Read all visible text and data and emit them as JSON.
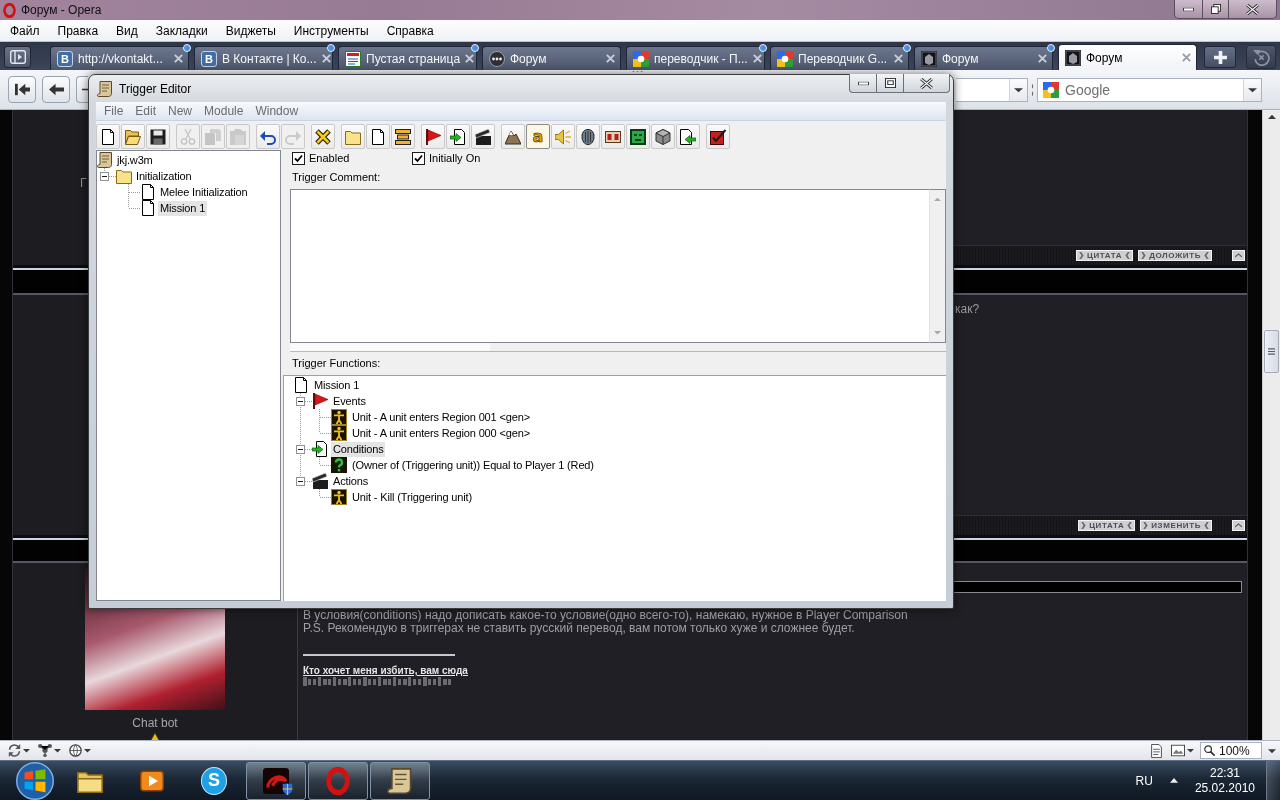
{
  "browser": {
    "title": "Форум - Opera",
    "menu": [
      "Файл",
      "Правка",
      "Вид",
      "Закладки",
      "Виджеты",
      "Инструменты",
      "Справка"
    ],
    "tabs": [
      {
        "kind": "letter",
        "glyph": "В",
        "label": "http://vkontakt...",
        "selected": false,
        "notify": true
      },
      {
        "kind": "letter",
        "glyph": "В",
        "label": "В Контакте | Ко...",
        "selected": false,
        "notify": true
      },
      {
        "kind": "page",
        "label": "Пустая страница",
        "selected": false,
        "notify": true
      },
      {
        "kind": "dots",
        "label": "Форум",
        "selected": false,
        "notify": false
      },
      {
        "kind": "blocks",
        "label": "переводчик - П...",
        "selected": false,
        "notify": true
      },
      {
        "kind": "blocks",
        "label": "Переводчик G...",
        "selected": false,
        "notify": true
      },
      {
        "kind": "dark",
        "label": "Форум",
        "selected": false,
        "notify": true
      },
      {
        "kind": "dark",
        "label": "Форум",
        "selected": true,
        "notify": false
      }
    ],
    "search": {
      "placeholder": "Google"
    },
    "zoom": "100%"
  },
  "forum": {
    "fragment": "Г",
    "footers": [
      {
        "buttons": [
          "ЦИТАТА",
          "ДОЛОЖИТЬ"
        ]
      },
      {
        "buttons": [
          "ЦИТАТА",
          "ИЗМЕНИТЬ"
        ]
      }
    ],
    "question_tail": "как?",
    "author": "Chat bot",
    "reply": [
      "В условия(conditions) надо дописать какое-то условие(одно всего-то), намекаю, нужное в Player Comparison",
      "P.S. Рекомендую в триггерах не ставить русский перевод, вам потом только хуже и сложнее будет."
    ],
    "signature_link": "Кто хочет меня избить, вам сюда"
  },
  "editor": {
    "title": "Trigger Editor",
    "menu": [
      "File",
      "Edit",
      "New",
      "Module",
      "Window"
    ],
    "toolbar": [
      [
        {
          "kind": "new",
          "disabled": false,
          "pressed": false
        },
        {
          "kind": "open",
          "disabled": false,
          "pressed": false
        },
        {
          "kind": "save",
          "disabled": false,
          "pressed": false
        }
      ],
      [
        {
          "kind": "cut",
          "disabled": true,
          "pressed": false
        },
        {
          "kind": "copy",
          "disabled": true,
          "pressed": false
        },
        {
          "kind": "paste",
          "disabled": true,
          "pressed": false
        }
      ],
      [
        {
          "kind": "undo",
          "disabled": false,
          "pressed": false
        },
        {
          "kind": "redo",
          "disabled": true,
          "pressed": false
        }
      ],
      [
        {
          "kind": "variables",
          "disabled": false,
          "pressed": false
        }
      ],
      [
        {
          "kind": "category",
          "disabled": false,
          "pressed": false
        },
        {
          "kind": "trigger",
          "disabled": false,
          "pressed": false
        },
        {
          "kind": "comment",
          "disabled": false,
          "pressed": false
        }
      ],
      [
        {
          "kind": "event",
          "disabled": false,
          "pressed": false
        },
        {
          "kind": "condition",
          "disabled": false,
          "pressed": false
        },
        {
          "kind": "action",
          "disabled": false,
          "pressed": false
        }
      ],
      [
        {
          "kind": "terrain",
          "disabled": false,
          "pressed": false
        },
        {
          "kind": "glyph",
          "glyph": "a",
          "disabled": false,
          "pressed": true
        },
        {
          "kind": "sound",
          "disabled": false,
          "pressed": false
        },
        {
          "kind": "ai",
          "disabled": false,
          "pressed": false
        },
        {
          "kind": "object",
          "disabled": false,
          "pressed": false
        },
        {
          "kind": "campaign",
          "disabled": false,
          "pressed": false
        },
        {
          "kind": "import",
          "disabled": false,
          "pressed": false
        },
        {
          "kind": "export",
          "disabled": false,
          "pressed": false
        }
      ],
      [
        {
          "kind": "test",
          "disabled": false,
          "pressed": false
        }
      ]
    ],
    "trigger_tree": [
      {
        "kind": "map",
        "label": "jkj.w3m",
        "selected": false,
        "children": [
          {
            "kind": "category",
            "label": "Initialization",
            "selected": false,
            "expanded": true,
            "children": [
              {
                "kind": "trigger",
                "label": "Melee Initialization",
                "selected": false
              },
              {
                "kind": "trigger",
                "label": "Mission 1",
                "selected": true
              }
            ]
          }
        ]
      }
    ],
    "options": [
      {
        "label": "Enabled",
        "checked": true
      },
      {
        "label": "Initially On",
        "checked": true
      }
    ],
    "comment": {
      "label": "Trigger Comment:"
    },
    "functions": {
      "label": "Trigger Functions:",
      "tree": [
        {
          "kind": "trigger",
          "label": "Mission 1",
          "selected": false,
          "children": [
            {
              "kind": "events",
              "label": "Events",
              "selected": false,
              "expanded": true,
              "children": [
                {
                  "kind": "unit",
                  "label": "Unit - A unit enters Region 001 <gen>",
                  "selected": false
                },
                {
                  "kind": "unit",
                  "label": "Unit - A unit enters Region 000 <gen>",
                  "selected": false
                }
              ]
            },
            {
              "kind": "conditions",
              "label": "Conditions",
              "selected": true,
              "expanded": true,
              "children": [
                {
                  "kind": "question",
                  "label": "(Owner of (Triggering unit)) Equal to Player 1 (Red)",
                  "selected": false
                }
              ]
            },
            {
              "kind": "actions",
              "label": "Actions",
              "selected": false,
              "expanded": true,
              "children": [
                {
                  "kind": "unit",
                  "label": "Unit - Kill (Triggering unit)",
                  "selected": false
                }
              ]
            }
          ]
        }
      ]
    }
  },
  "taskbar": {
    "apps": [
      {
        "kind": "explorer",
        "running": false
      },
      {
        "kind": "media",
        "running": false
      },
      {
        "kind": "skype",
        "glyph": "S",
        "running": false
      },
      {
        "kind": "game",
        "running": true
      },
      {
        "kind": "opera",
        "running": true
      },
      {
        "kind": "editor",
        "running": true
      }
    ],
    "language": "RU",
    "time": "22:31",
    "date": "25.02.2010"
  }
}
